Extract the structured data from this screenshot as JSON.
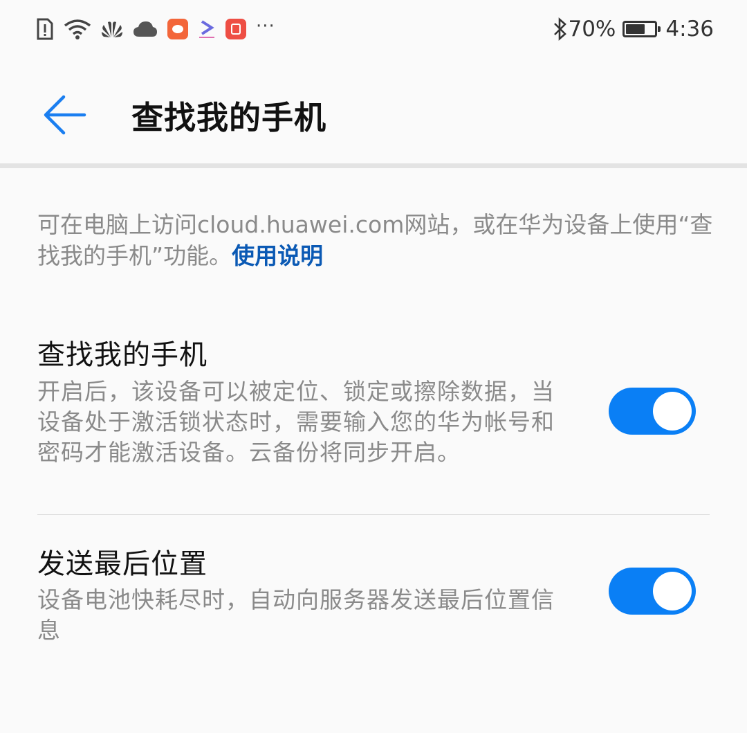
{
  "status_bar": {
    "icons": [
      "sim-alert-icon",
      "wifi-icon",
      "huawei-logo-icon",
      "cloud-icon",
      "weibo-app-icon",
      "video-app-icon",
      "jd-app-icon",
      "more-icon"
    ],
    "more": "···",
    "bluetooth_icon": "bluetooth-icon",
    "battery_percent_text": "70%",
    "battery_level": 0.7,
    "time": "4:36"
  },
  "header": {
    "title": "查找我的手机",
    "back_icon": "arrow-left-icon"
  },
  "intro": {
    "text": "可在电脑上访问cloud.huawei.com网站，或在华为设备上使用“查找我的手机”功能。",
    "link": "使用说明"
  },
  "settings": [
    {
      "title": "查找我的手机",
      "description": "开启后，该设备可以被定位、锁定或擦除数据，当设备处于激活锁状态时，需要输入您的华为帐号和密码才能激活设备。云备份将同步开启。",
      "enabled": true
    },
    {
      "title": "发送最后位置",
      "description": "设备电池快耗尽时，自动向服务器发送最后位置信息",
      "enabled": true
    }
  ],
  "colors": {
    "accent": "#0a7ff5",
    "link": "#0a59b4",
    "secondary_text": "#8a8a8a",
    "background": "#fafafa"
  }
}
